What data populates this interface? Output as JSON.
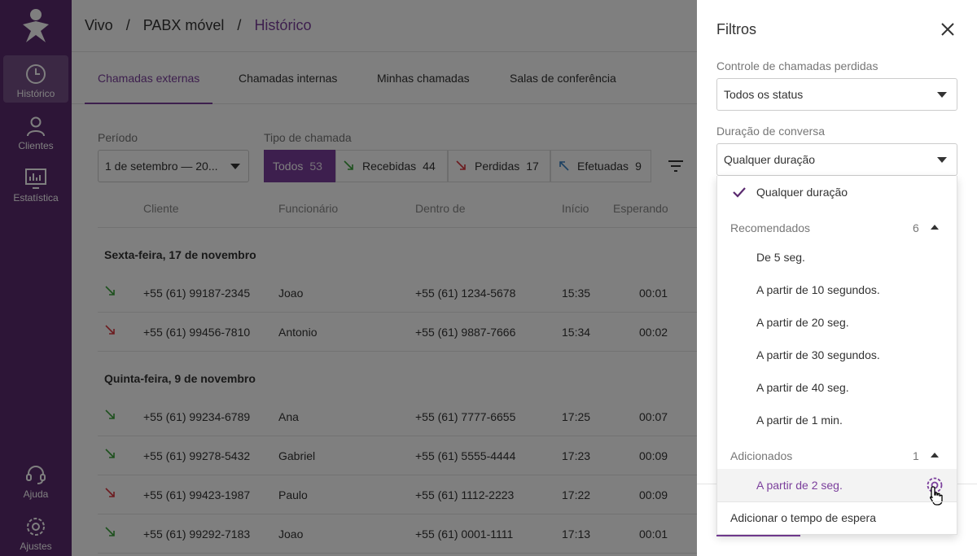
{
  "sidebar": {
    "items": [
      {
        "label": "Histórico",
        "icon": "clock-icon"
      },
      {
        "label": "Clientes",
        "icon": "person-icon"
      },
      {
        "label": "Estatística",
        "icon": "chart-icon"
      },
      {
        "label": "Ajuda",
        "icon": "headset-icon"
      },
      {
        "label": "Ajustes",
        "icon": "gear-icon"
      }
    ]
  },
  "breadcrumb": {
    "items": [
      "Vivo",
      "PABX móvel",
      "Histórico"
    ],
    "separator": "/"
  },
  "tabs": [
    "Chamadas externas",
    "Chamadas internas",
    "Minhas chamadas",
    "Salas de conferência"
  ],
  "filters": {
    "period_label": "Período",
    "period_value": "1 de setembro — 20...",
    "call_type_label": "Tipo de chamada",
    "call_types": [
      {
        "label": "Todos",
        "count": "53"
      },
      {
        "label": "Recebidas",
        "count": "44"
      },
      {
        "label": "Perdidas",
        "count": "17"
      },
      {
        "label": "Efetuadas",
        "count": "9"
      }
    ]
  },
  "table": {
    "columns": [
      "Cliente",
      "Funcionário",
      "Dentro de",
      "Início",
      "Esperando"
    ],
    "groups": [
      {
        "title": "Sexta-feira, 17 de novembro",
        "rows": [
          {
            "type": "received",
            "client": "+55 (61) 99187-2345",
            "employee": "Joao",
            "within": "+55 (61) 1234-5678",
            "start": "15:35",
            "wait": "00:01"
          },
          {
            "type": "missed",
            "client": "+55 (61) 99456-7810",
            "employee": "Antonio",
            "within": "+55 (61) 9887-7666",
            "start": "15:34",
            "wait": "00:02"
          }
        ]
      },
      {
        "title": "Quinta-feira, 9 de novembro",
        "rows": [
          {
            "type": "received",
            "client": "+55 (61) 99234-6789",
            "employee": "Ana",
            "within": "+55 (61) 7777-6655",
            "start": "17:25",
            "wait": "00:07"
          },
          {
            "type": "received",
            "client": "+55 (61) 99278-5432",
            "employee": "Gabriel",
            "within": "+55 (61) 5555-4444",
            "start": "17:23",
            "wait": "00:09"
          },
          {
            "type": "missed",
            "client": "+55 (61) 99423-1987",
            "employee": "Paulo",
            "within": "+55 (61) 1112-2223",
            "start": "17:22",
            "wait": "00:09"
          },
          {
            "type": "received",
            "client": "+55 (61) 99292-7183",
            "employee": "Joao",
            "within": "+55 (61) 0001-1111",
            "start": "17:13",
            "wait": "00:01"
          }
        ]
      }
    ]
  },
  "panel": {
    "title": "Filtros",
    "missed_label": "Controle de chamadas perdidas",
    "missed_value": "Todos os status",
    "duration_label": "Duração de conversa",
    "duration_value": "Qualquer duração"
  },
  "dropdown": {
    "selected": "Qualquer duração",
    "recommended_title": "Recomendados",
    "recommended_count": "6",
    "recommended": [
      "De 5 seg.",
      "A partir de 10 segundos.",
      "A partir de 20 seg.",
      "A partir de 30 segundos.",
      "A partir de 40 seg.",
      "A partir de 1 min."
    ],
    "added_title": "Adicionados",
    "added_count": "1",
    "added": [
      "A partir de 2 seg."
    ],
    "add_action": "Adicionar o tempo de espera"
  },
  "colors": {
    "accent": "#7b3f9c",
    "sidebar": "#5a2a6f",
    "received": "#3aa03a",
    "missed": "#d9363e",
    "outgoing": "#3b82c4"
  }
}
